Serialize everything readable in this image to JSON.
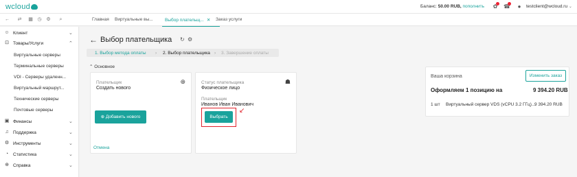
{
  "app": {
    "logo": "wcloud"
  },
  "header": {
    "balance_label": "Баланс:",
    "balance_value": "50.00 RUB,",
    "topup_link": "пополнить",
    "user_email": "testclient@wcloud.ru"
  },
  "tabs": [
    {
      "label": "Главная"
    },
    {
      "label": "Виртуальные вы..."
    },
    {
      "label": "Выбор плательщ..."
    },
    {
      "label": "Заказ услуги"
    }
  ],
  "sidebar": {
    "items": [
      {
        "label": "Клиент",
        "icon": "user-icon"
      },
      {
        "label": "Товары/Услуги",
        "icon": "cart-icon"
      },
      {
        "label": "Финансы",
        "icon": "wallet-icon"
      },
      {
        "label": "Поддержка",
        "icon": "headset-icon"
      },
      {
        "label": "Инструменты",
        "icon": "gear-icon"
      },
      {
        "label": "Статистика",
        "icon": "chart-icon"
      },
      {
        "label": "Справка",
        "icon": "help-icon"
      }
    ],
    "subitems": [
      "Виртуальные серверы",
      "Терминальные серверы",
      "VDI - Серверы удаленн...",
      "Виртуальный маршрут...",
      "Технические серверы",
      "Почтовые серверы"
    ]
  },
  "page": {
    "title": "Выбор плательщика",
    "steps": [
      "1. Выбор метода оплаты",
      "2. Выбор плательщика",
      "3. Завершение оплаты"
    ],
    "section": "Основное",
    "card_new": {
      "label": "Плательщик",
      "value": "Создать нового",
      "button": "Добавить нового"
    },
    "card_existing": {
      "status_label": "Статус плательщика",
      "status_value": "Физическое лицо",
      "payer_label": "Плательщик",
      "payer_value": "Иванов Иван Иванович",
      "button": "Выбрать"
    },
    "cancel": "Отмена"
  },
  "cart": {
    "title": "Ваша корзина",
    "edit_button": "Изменить заказ",
    "summary_label": "Оформляем 1 позицию на",
    "summary_value": "9 394.20 RUB",
    "item_qty": "1 шт",
    "item_name": "Виртуальный сервер VDS (vCPU 3.2 ГГц)...",
    "item_price": "9 394.20 RUB"
  },
  "colors": {
    "accent": "#1aa39c",
    "highlight": "#e0212b"
  }
}
